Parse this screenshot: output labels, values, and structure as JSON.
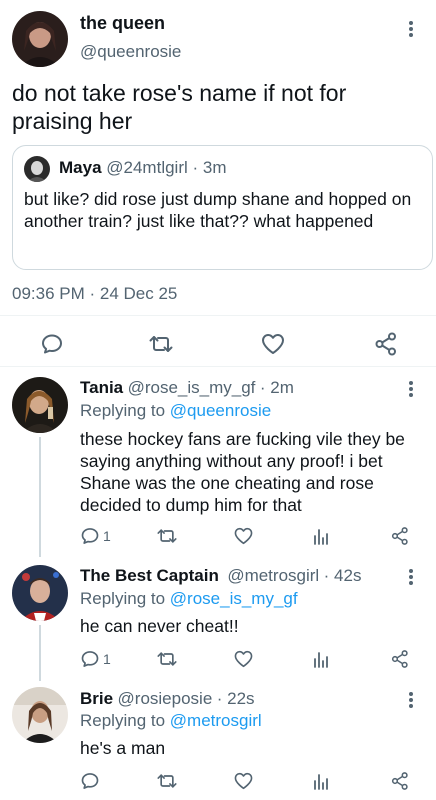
{
  "main_tweet": {
    "name": "the queen",
    "handle": "@queenrosie",
    "text": "do not take rose's name if not for praising her",
    "timestamp": "09:36 PM · 24 Dec 25"
  },
  "quoted_tweet": {
    "name": "Maya",
    "handle": "@24mtlgirl",
    "time": "· 3m",
    "text": "but like? did rose just dump shane and hopped on another train? just like that?? what happened"
  },
  "replies": [
    {
      "name": "Tania",
      "handle": "@rose_is_my_gf",
      "time": "· 2m",
      "replying_prefix": "Replying to",
      "replying_to": "@queenrosie",
      "text": "these hockey fans are fucking vile they be saying anything without any proof! i bet Shane was the one cheating and rose decided to dump him for that",
      "reply_count": "1"
    },
    {
      "name": "The Best Captain",
      "handle": "@metrosgirl",
      "time": "· 42s",
      "replying_prefix": "Replying to",
      "replying_to": "@rose_is_my_gf",
      "text": "he can never cheat!!",
      "reply_count": "1"
    },
    {
      "name": "Brie",
      "handle": "@rosieposie",
      "time": "· 22s",
      "replying_prefix": "Replying to",
      "replying_to": "@metrosgirl",
      "text": "he's a man",
      "reply_count": ""
    }
  ],
  "icons": {
    "reply": "reply-icon",
    "retweet": "retweet-icon",
    "like": "heart-icon",
    "share": "share-icon",
    "views": "views-icon",
    "more": "more-icon"
  },
  "colors": {
    "link": "#1d9bf0",
    "secondary_text": "#536471",
    "thread_line": "#cfd9de"
  }
}
